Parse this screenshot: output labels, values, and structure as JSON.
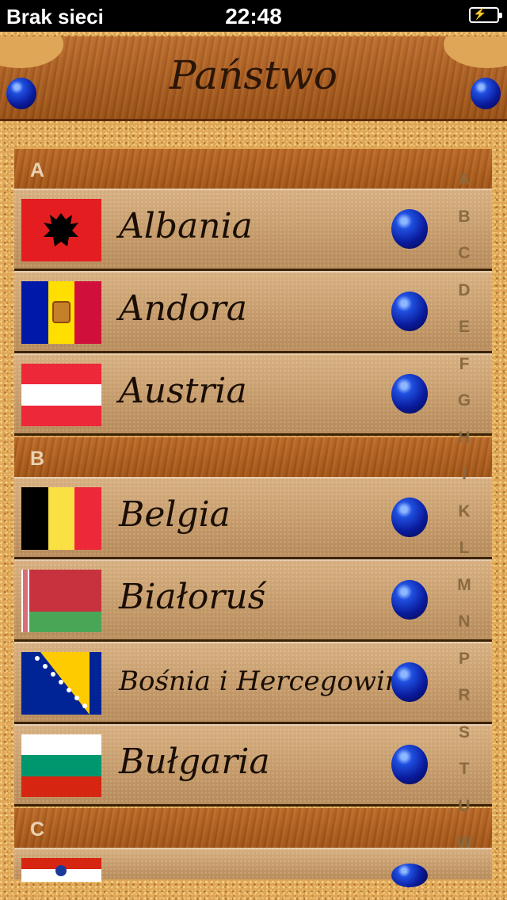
{
  "status": {
    "carrier": "Brak sieci",
    "time": "22:48",
    "battery_icon": "battery-charging-icon"
  },
  "header": {
    "title": "Państwo"
  },
  "sections": [
    {
      "letter": "A",
      "rows": [
        {
          "name": "Albania",
          "flag": "albania"
        },
        {
          "name": "Andora",
          "flag": "andorra"
        },
        {
          "name": "Austria",
          "flag": "austria"
        }
      ]
    },
    {
      "letter": "B",
      "rows": [
        {
          "name": "Belgia",
          "flag": "belgium"
        },
        {
          "name": "Białoruś",
          "flag": "belarus"
        },
        {
          "name": "Bośnia i Hercegowina",
          "flag": "bosnia"
        },
        {
          "name": "Bułgaria",
          "flag": "bulgaria"
        }
      ]
    },
    {
      "letter": "C",
      "rows": []
    }
  ],
  "index": [
    "A",
    "B",
    "C",
    "D",
    "E",
    "F",
    "G",
    "H",
    "I",
    "K",
    "L",
    "M",
    "N",
    "P",
    "R",
    "S",
    "T",
    "U",
    "W"
  ],
  "colors": {
    "header_wood": "#b5621e",
    "row": "#c99a66",
    "ball": "#0a1a9a"
  }
}
